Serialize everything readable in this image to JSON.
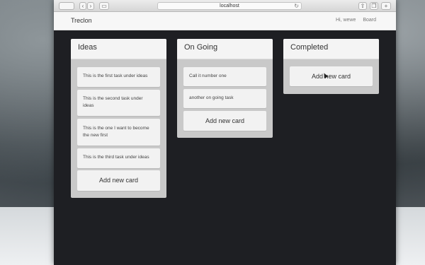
{
  "browser": {
    "url": "localhost",
    "back_icon": "chevron-left-icon",
    "forward_icon": "chevron-right-icon"
  },
  "navbar": {
    "brand": "Treclon",
    "greeting": "Hi, wewe",
    "board_link": "Board"
  },
  "lists": [
    {
      "title": "Ideas",
      "cards": [
        "This is the first task under ideas",
        "This is the second task under ideas",
        "This is the one I want to become the new first",
        "This is the third task under ideas"
      ],
      "add_label": "Add new card"
    },
    {
      "title": "On Going",
      "cards": [
        "Call it number one",
        "another on going task"
      ],
      "add_label": "Add new card"
    },
    {
      "title": "Completed",
      "cards": [],
      "add_label": "Add new card"
    }
  ],
  "colors": {
    "board_bg": "#1e1f23",
    "list_bg": "#c9c9c9",
    "card_bg": "#f2f2f2"
  }
}
